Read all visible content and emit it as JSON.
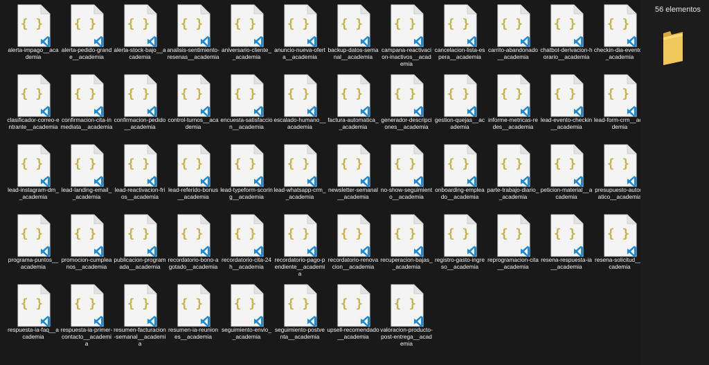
{
  "status": {
    "item_count": "56 elementos"
  },
  "colors": {
    "brace": "#c7b349",
    "vscode": "#1e8ad6",
    "page": "#f4f4f4",
    "background": "#191919"
  },
  "files": [
    "alerta-impago__academia",
    "alerta-pedido-grande__academia",
    "alerta-stock-bajo__academia",
    "analisis-sentimiento-resenas__academia",
    "aniversario-cliente__academia",
    "anuncio-nueva-oferta__academia",
    "backup-datos-semanal__academia",
    "campana-reactivacion-inactivos__academia",
    "cancelacion-lista-espera__academia",
    "carrito-abandonado__academia",
    "chatbot-derivacion-horario__academia",
    "checkin-dia-evento__academia",
    "clasificador-correo-entrante__academia",
    "confirmacion-cita-inmediata__academia",
    "confirmacion-pedido__academia",
    "control-turnos__academia",
    "encuesta-satisfaccion__academia",
    "escalado-humano__academia",
    "factura-automatica__academia",
    "generador-descripciones__academia",
    "gestion-quejas__academia",
    "informe-metricas-redes__academia",
    "lead-evento-checkin__academia",
    "lead-form-crm__academia",
    "lead-instagram-dm__academia",
    "lead-landing-email__academia",
    "lead-reactivacion-frios__academia",
    "lead-referido-bonus__academia",
    "lead-typeform-scoring__academia",
    "lead-whatsapp-crm__academia",
    "newsletter-semanal__academia",
    "no-show-seguimiento__academia",
    "onboarding-empleado__academia",
    "parte-trabajo-diario__academia",
    "peticion-material__academia",
    "presupuesto-automatico__academia",
    "programa-puntos__academia",
    "promocion-cumpleanos__academia",
    "publicacion-programada__academia",
    "recordatorio-bono-agotado__academia",
    "recordatorio-cita-24h__academia",
    "recordatorio-pago-pendiente__academia",
    "recordatorio-renovacion__academia",
    "recuperacion-bajas__academia",
    "registro-gasto-ingreso__academia",
    "reprogramacion-cita__academia",
    "resena-respuesta-ia__academia",
    "resena-solicitud__academia",
    "respuesta-ia-faq__academia",
    "respuesta-ia-primer-contacto__academia",
    "resumen-facturacion-semanal__academia",
    "resumen-ia-reuniones__academia",
    "seguimiento-envio__academia",
    "seguimiento-postventa__academia",
    "upsell-recomendado__academia",
    "valoracion-producto-post-entrega__academia"
  ]
}
